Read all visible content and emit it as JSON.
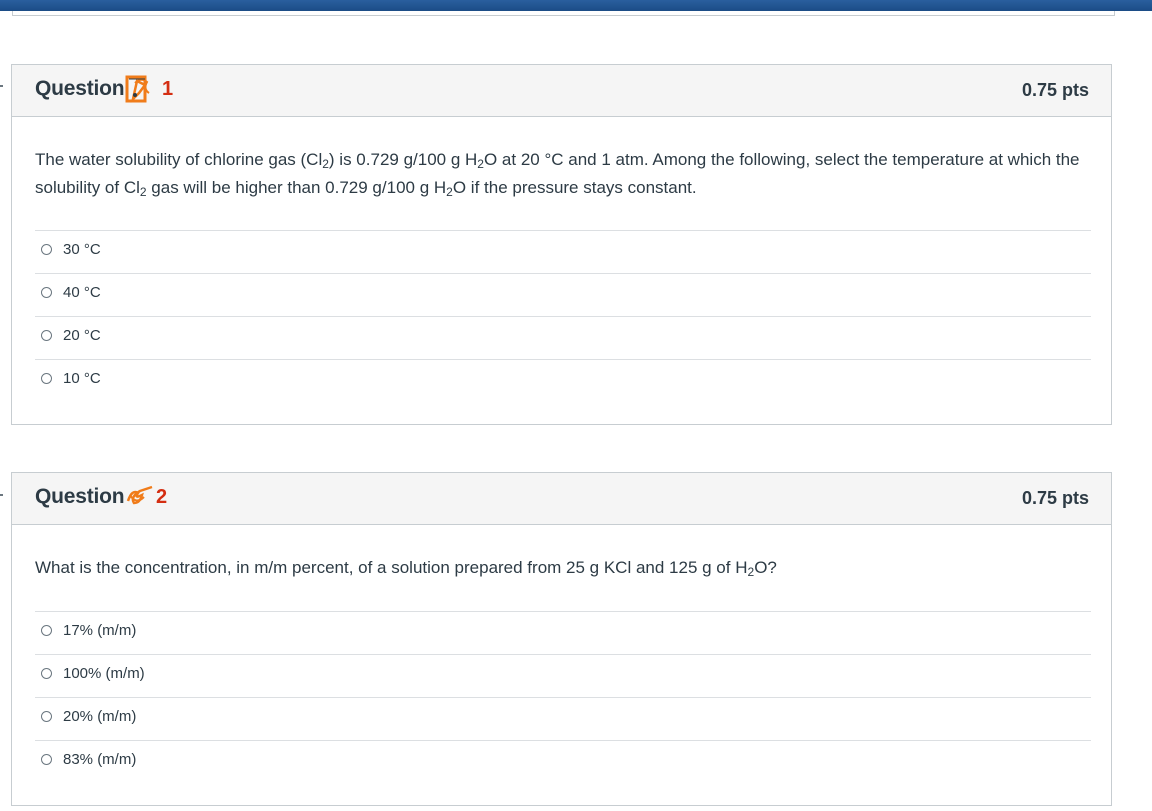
{
  "colors": {
    "topbar": "#1b4c86",
    "question_number": "#d42e12",
    "text": "#2d3b45",
    "header_bg": "#f5f5f5",
    "annotation": "#f07c1a"
  },
  "questions": [
    {
      "title": "Question",
      "number": "1",
      "points": "0.75 pts",
      "text_segments": [
        "The water solubility of chlorine gas (Cl",
        "2",
        ") is 0.729 g/100 g H",
        "2",
        "O at 20 °C and 1 atm. Among the following, select the temperature at which the solubility of Cl",
        "2",
        " gas will be higher than 0.729 g/100 g H",
        "2",
        "O if the pressure stays constant."
      ],
      "answers": [
        "30 °C",
        "40 °C",
        "20 °C",
        "10 °C"
      ],
      "annotation_icon": "flag-scribble-icon"
    },
    {
      "title": "Question",
      "number": "2",
      "points": "0.75 pts",
      "text_segments": [
        "What is the concentration, in m/m percent, of a solution prepared from 25 g KCl and 125 g of H",
        "2",
        "O?"
      ],
      "answers": [
        "17% (m/m)",
        "100% (m/m)",
        "20% (m/m)",
        "83% (m/m)"
      ],
      "annotation_icon": "scribble-icon"
    }
  ]
}
